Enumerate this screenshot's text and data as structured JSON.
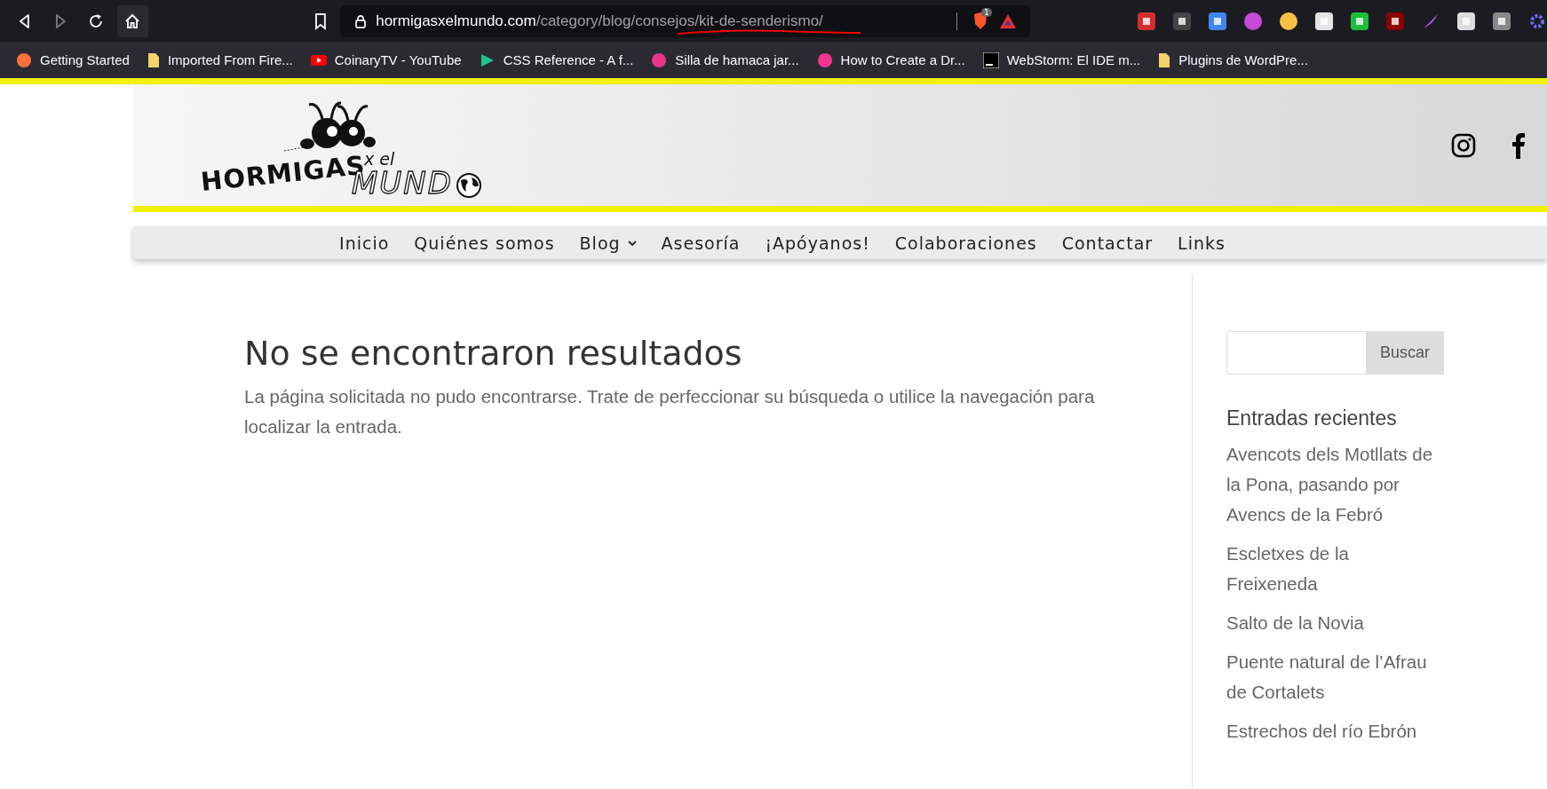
{
  "browser": {
    "url_host": "hormigasxelmundo.com",
    "url_path": "/category/blog/consejos/kit-de-senderismo/",
    "brave_badge": "1",
    "bookmarks": [
      {
        "label": "Getting Started",
        "kind": "firefox"
      },
      {
        "label": "Imported From Fire...",
        "kind": "folder"
      },
      {
        "label": "CoinaryTV - YouTube",
        "kind": "youtube"
      },
      {
        "label": "CSS Reference - A f...",
        "kind": "css"
      },
      {
        "label": "Silla de hamaca jar...",
        "kind": "silla"
      },
      {
        "label": "How to Create a Dr...",
        "kind": "asterisk"
      },
      {
        "label": "WebStorm: El IDE m...",
        "kind": "jb"
      },
      {
        "label": "Plugins de WordPre...",
        "kind": "folder"
      }
    ]
  },
  "site": {
    "logo": {
      "word1": "HORMIGAS",
      "word2": "x el",
      "word3": "MUND"
    },
    "nav": [
      {
        "label": "Inicio",
        "dropdown": false
      },
      {
        "label": "Quiénes somos",
        "dropdown": false
      },
      {
        "label": "Blog",
        "dropdown": true
      },
      {
        "label": "Asesoría",
        "dropdown": false
      },
      {
        "label": "¡Apóyanos!",
        "dropdown": false
      },
      {
        "label": "Colaboraciones",
        "dropdown": false
      },
      {
        "label": "Contactar",
        "dropdown": false
      },
      {
        "label": "Links",
        "dropdown": false
      }
    ],
    "main": {
      "title": "No se encontraron resultados",
      "text": "La página solicitada no pudo encontrarse. Trate de perfeccionar su búsqueda o utilice la navegación para localizar la entrada."
    },
    "sidebar": {
      "search_button": "Buscar",
      "recent_title": "Entradas recientes",
      "recent": [
        "Avencots dels Motllats de la Pona, pasando por Avencs de la Febró",
        "Escletxes de la Freixeneda",
        "Salto de la Novia",
        "Puente natural de l’Afrau de Cortalets",
        "Estrechos del río Ebrón"
      ]
    }
  }
}
